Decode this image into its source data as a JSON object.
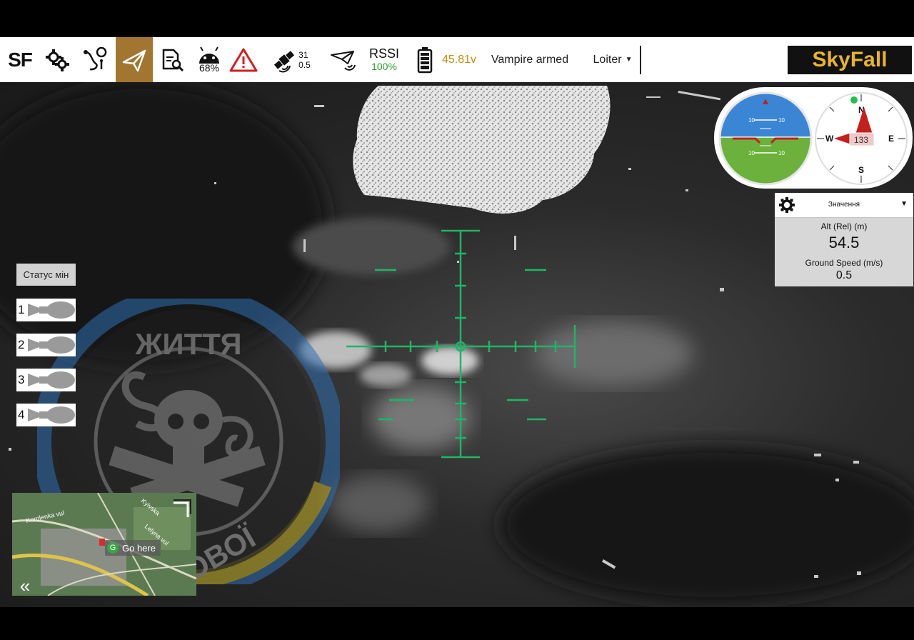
{
  "toolbar": {
    "sf_label": "SF",
    "android_battery": "68%",
    "gps_sats": "31",
    "gps_hdop": "0.5",
    "rssi_label": "RSSI",
    "rssi_value": "100%",
    "battery_voltage": "45.81v",
    "arm_status": "Vampire armed",
    "flight_mode": "Loiter",
    "brand": "SkyFall",
    "icons": [
      "gears-icon",
      "route-icon",
      "paper-plane-icon",
      "report-icon",
      "android-icon",
      "warning-icon",
      "satellite-icon",
      "link-icon",
      "battery-icon"
    ]
  },
  "compass": {
    "heading": "133",
    "north": "N",
    "south": "S",
    "east": "E",
    "west": "W"
  },
  "horizon": {
    "ticks": [
      "10",
      "10",
      "10",
      "10"
    ]
  },
  "telemetry": {
    "title": "Значення",
    "alt_label": "Alt (Rel) (m)",
    "alt_value": "54.5",
    "gs_label": "Ground Speed (m/s)",
    "gs_value": "0.5"
  },
  "mines": {
    "label": "Статус мін",
    "slots": [
      "1",
      "2",
      "3",
      "4"
    ]
  },
  "watermark": {
    "top_text": "ЖИТТЯ",
    "bottom_text": "ДОВОЇ"
  },
  "map": {
    "go_here": "Go here",
    "go_badge": "G",
    "street_1": "Korolenka vul",
    "street_2": "Kyivska",
    "street_3": "Lelyna vul",
    "collapse": "«"
  },
  "colors": {
    "accent": "#a27531",
    "brand_bg": "#111111",
    "brand_fg": "#e8b529",
    "reticle": "#1fb566",
    "voltage": "#c98d0d",
    "rssi": "#2ba12b"
  }
}
